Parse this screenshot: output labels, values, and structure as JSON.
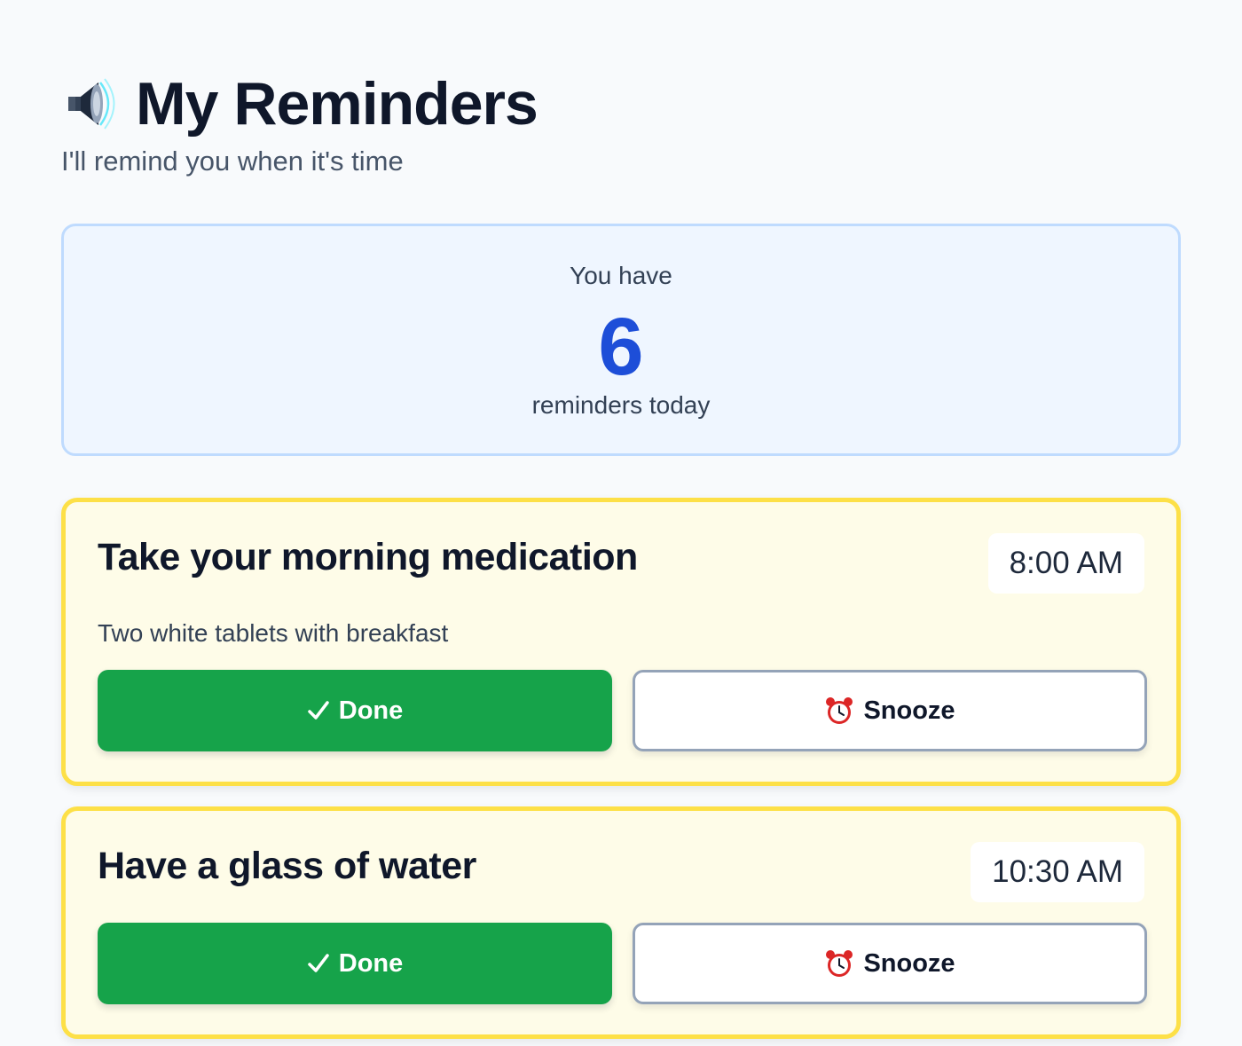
{
  "header": {
    "icon": "speaker-icon",
    "title": "My Reminders",
    "subtitle": "I'll remind you when it's time"
  },
  "summary": {
    "pre_text": "You have",
    "count": "6",
    "post_text": "reminders today"
  },
  "reminders": [
    {
      "title": "Take your morning medication",
      "time": "8:00 AM",
      "description": "Two white tablets with breakfast",
      "done_label": "Done",
      "snooze_label": "Snooze"
    },
    {
      "title": "Have a glass of water",
      "time": "10:30 AM",
      "done_label": "Done",
      "snooze_label": "Snooze"
    }
  ],
  "colors": {
    "accent": "#1d4ed8",
    "done": "#16a34a",
    "card_border": "#fde047",
    "card_bg": "#fefce8",
    "summary_bg": "#eff6ff"
  },
  "icons": {
    "done": "check-icon",
    "snooze": "alarm-clock-icon"
  }
}
